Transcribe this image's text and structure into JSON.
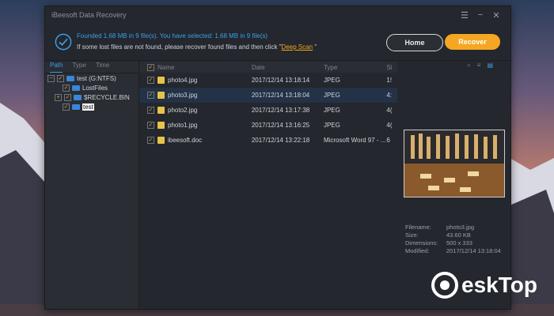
{
  "window": {
    "title": "iBeesoft Data Recovery"
  },
  "banner": {
    "found_text": "Founded 1.68 MB in 9 file(s).   You have selected: 1.68 MB in 9 file(s)",
    "hint_text": "If some lost files are not found, please recover found files and then click \"",
    "deep_scan": "Deep Scan",
    "hint_end": " \"",
    "home_label": "Home",
    "recover_label": "Recover"
  },
  "tabs": [
    {
      "label": "Path"
    },
    {
      "label": "Type"
    },
    {
      "label": "Time"
    }
  ],
  "tree": {
    "root": "test (G:NTFS)",
    "items": [
      {
        "label": "LostFiles"
      },
      {
        "label": "$RECYCLE.BIN"
      },
      {
        "label": "test"
      }
    ]
  },
  "table": {
    "headers": {
      "name": "Name",
      "date": "Date",
      "type": "Type",
      "size": "Si"
    },
    "rows": [
      {
        "name": "photo4.jpg",
        "date": "2017/12/14 13:18:14",
        "type": "JPEG",
        "size": "1!"
      },
      {
        "name": "photo3.jpg",
        "date": "2017/12/14 13:18:04",
        "type": "JPEG",
        "size": "4:"
      },
      {
        "name": "photo2.jpg",
        "date": "2017/12/14 13:17:38",
        "type": "JPEG",
        "size": "4("
      },
      {
        "name": "photo1.jpg",
        "date": "2017/12/14 13:16:25",
        "type": "JPEG",
        "size": "4("
      },
      {
        "name": "ibeesoft.doc",
        "date": "2017/12/14 13:22:18",
        "type": "Microsoft Word 97 - ...",
        "size": "6"
      }
    ]
  },
  "info": {
    "filename_label": "Filename:",
    "filename": "photo3.jpg",
    "size_label": "Size:",
    "size": "43.60 KB",
    "dimensions_label": "Dimensions:",
    "dimensions": "500 x 333",
    "modified_label": "Modified:",
    "modified": "2017/12/14 13:18:04"
  },
  "watermark": {
    "text": "eskTop"
  },
  "colors": {
    "accent": "#3aa0e8",
    "recover": "#f5a623"
  }
}
